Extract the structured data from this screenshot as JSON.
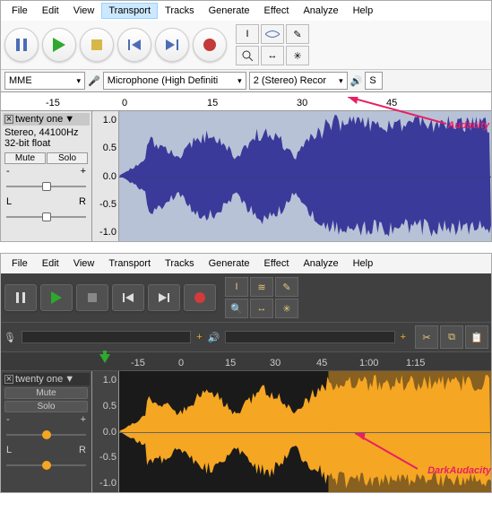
{
  "audacity": {
    "menu": [
      "File",
      "Edit",
      "View",
      "Transport",
      "Tracks",
      "Generate",
      "Effect",
      "Analyze",
      "Help"
    ],
    "selectedMenu": "Transport",
    "host": "MME",
    "device": "Microphone (High Definiti",
    "channels": "2 (Stereo) Recor",
    "ruler": [
      "-15",
      "0",
      "15",
      "30",
      "45"
    ],
    "track": {
      "name": "twenty one",
      "rate": "Stereo, 44100Hz",
      "fmt": "32-bit float",
      "mute": "Mute",
      "solo": "Solo",
      "gainL": "-",
      "gainR": "+",
      "panL": "L",
      "panR": "R",
      "scale": [
        "1.0",
        "0.5",
        "0.0",
        "-0.5",
        "-1.0"
      ]
    },
    "label": "Audacity"
  },
  "dark": {
    "menu": [
      "File",
      "Edit",
      "View",
      "Transport",
      "Tracks",
      "Generate",
      "Effect",
      "Analyze",
      "Help"
    ],
    "ruler": [
      "-15",
      "0",
      "15",
      "30",
      "45",
      "1:00",
      "1:15"
    ],
    "track": {
      "name": "twenty one",
      "mute": "Mute",
      "solo": "Solo",
      "gainL": "-",
      "gainR": "+",
      "panL": "L",
      "panR": "R",
      "scale": [
        "1.0",
        "0.5",
        "0.0",
        "-0.5",
        "-1.0"
      ]
    },
    "label": "DarkAudacity"
  }
}
